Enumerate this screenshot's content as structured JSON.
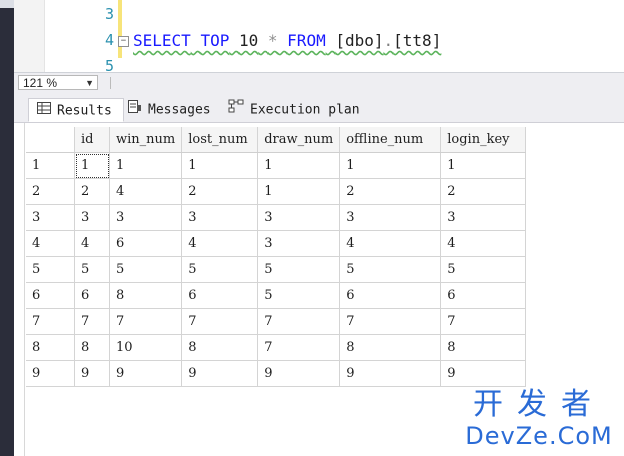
{
  "editor": {
    "line_numbers": [
      "3",
      "4",
      "5"
    ],
    "query": {
      "kw_select": "SELECT",
      "kw_top": "TOP",
      "top_count": "10",
      "star": "*",
      "kw_from": "FROM",
      "schema": "[dbo]",
      "dot": ".",
      "table": "[tt8]"
    }
  },
  "zoom": {
    "value": "121 %"
  },
  "tabs": [
    {
      "label": "Results",
      "icon": "grid-icon"
    },
    {
      "label": "Messages",
      "icon": "messages-icon"
    },
    {
      "label": "Execution plan",
      "icon": "execution-plan-icon"
    }
  ],
  "grid": {
    "columns": [
      "id",
      "win_num",
      "lost_num",
      "draw_num",
      "offline_num",
      "login_key"
    ],
    "rows": [
      {
        "n": "1",
        "cells": [
          "1",
          "1",
          "1",
          "1",
          "1",
          "1"
        ]
      },
      {
        "n": "2",
        "cells": [
          "2",
          "4",
          "2",
          "1",
          "2",
          "2"
        ]
      },
      {
        "n": "3",
        "cells": [
          "3",
          "3",
          "3",
          "3",
          "3",
          "3"
        ]
      },
      {
        "n": "4",
        "cells": [
          "4",
          "6",
          "4",
          "3",
          "4",
          "4"
        ]
      },
      {
        "n": "5",
        "cells": [
          "5",
          "5",
          "5",
          "5",
          "5",
          "5"
        ]
      },
      {
        "n": "6",
        "cells": [
          "6",
          "8",
          "6",
          "5",
          "6",
          "6"
        ]
      },
      {
        "n": "7",
        "cells": [
          "7",
          "7",
          "7",
          "7",
          "7",
          "7"
        ]
      },
      {
        "n": "8",
        "cells": [
          "8",
          "10",
          "8",
          "7",
          "8",
          "8"
        ]
      },
      {
        "n": "9",
        "cells": [
          "9",
          "9",
          "9",
          "9",
          "9",
          "9"
        ]
      }
    ]
  },
  "watermark": {
    "cn": "开发者",
    "en": "DevZe.CoM"
  },
  "colors": {
    "keyword": "#1a1aff",
    "line_number": "#2b91af",
    "watermark": "#2a6bd6"
  }
}
